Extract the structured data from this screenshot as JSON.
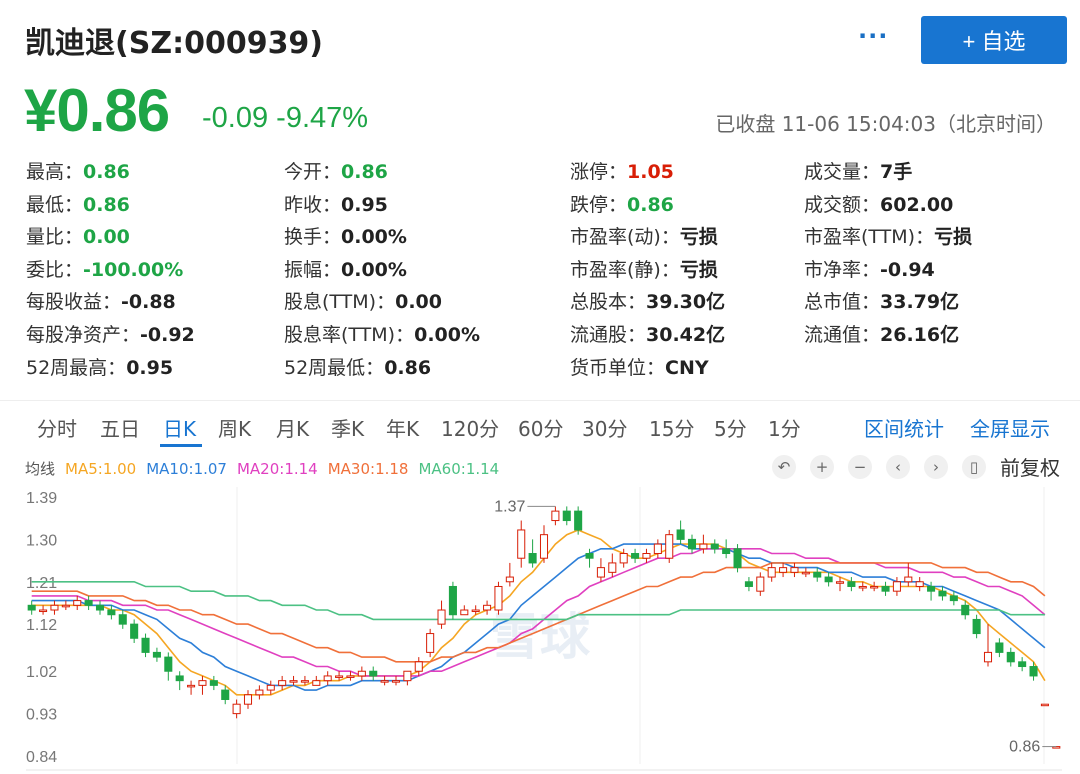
{
  "header": {
    "title": "凯迪退(SZ:000939)",
    "more_label": "···",
    "add_label": "+ 自选"
  },
  "quote": {
    "price": "¥0.86",
    "change": "-0.09 -9.47%",
    "status": "已收盘 11-06 15:04:03（北京时间）"
  },
  "stats": [
    {
      "label": "最高：",
      "value": "0.86",
      "color": "green"
    },
    {
      "label": "今开：",
      "value": "0.86",
      "color": "green"
    },
    {
      "label": "涨停：",
      "value": "1.05",
      "color": "red"
    },
    {
      "label": "成交量：",
      "value": "7手",
      "color": ""
    },
    {
      "label": "最低：",
      "value": "0.86",
      "color": "green"
    },
    {
      "label": "昨收：",
      "value": "0.95",
      "color": ""
    },
    {
      "label": "跌停：",
      "value": "0.86",
      "color": "green"
    },
    {
      "label": "成交额：",
      "value": "602.00",
      "color": ""
    },
    {
      "label": "量比：",
      "value": "0.00",
      "color": "green"
    },
    {
      "label": "换手：",
      "value": "0.00%",
      "color": ""
    },
    {
      "label": "市盈率(动)：",
      "value": "亏损",
      "color": ""
    },
    {
      "label": "市盈率(TTM)：",
      "value": "亏损",
      "color": ""
    },
    {
      "label": "委比：",
      "value": "-100.00%",
      "color": "green"
    },
    {
      "label": "振幅：",
      "value": "0.00%",
      "color": ""
    },
    {
      "label": "市盈率(静)：",
      "value": "亏损",
      "color": ""
    },
    {
      "label": "市净率：",
      "value": "-0.94",
      "color": ""
    },
    {
      "label": "每股收益：",
      "value": "-0.88",
      "color": ""
    },
    {
      "label": "股息(TTM)：",
      "value": "0.00",
      "color": ""
    },
    {
      "label": "总股本：",
      "value": "39.30亿",
      "color": ""
    },
    {
      "label": "总市值：",
      "value": "33.79亿",
      "color": ""
    },
    {
      "label": "每股净资产：",
      "value": "-0.92",
      "color": ""
    },
    {
      "label": "股息率(TTM)：",
      "value": "0.00%",
      "color": ""
    },
    {
      "label": "流通股：",
      "value": "30.42亿",
      "color": ""
    },
    {
      "label": "流通值：",
      "value": "26.16亿",
      "color": ""
    },
    {
      "label": "52周最高：",
      "value": "0.95",
      "color": ""
    },
    {
      "label": "52周最低：",
      "value": "0.86",
      "color": ""
    },
    {
      "label": "货币单位：",
      "value": "CNY",
      "color": ""
    }
  ],
  "tabs": [
    "分时",
    "五日",
    "日K",
    "周K",
    "月K",
    "季K",
    "年K",
    "120分",
    "60分",
    "30分",
    "15分",
    "5分",
    "1分"
  ],
  "active_tab": "日K",
  "tab_links": [
    "区间统计",
    "全屏显示"
  ],
  "legend": [
    {
      "text": "均线",
      "color": "#555555"
    },
    {
      "text": "MA5:1.00",
      "color": "#f5a623"
    },
    {
      "text": "MA10:1.07",
      "color": "#2d7fd8"
    },
    {
      "text": "MA20:1.14",
      "color": "#e040c0"
    },
    {
      "text": "MA30:1.18",
      "color": "#f0703a"
    },
    {
      "text": "MA60:1.14",
      "color": "#4cc184"
    }
  ],
  "tools": {
    "icons": [
      "undo-icon",
      "zoom-in-icon",
      "zoom-out-icon",
      "prev-icon",
      "next-icon",
      "candle-icon"
    ],
    "glyphs": [
      "↶",
      "+",
      "−",
      "‹",
      "›",
      "▯"
    ],
    "fq_label": "前复权"
  },
  "chart_data": {
    "type": "candlestick",
    "ylim": [
      0.84,
      1.39
    ],
    "y_ticks": [
      "1.39",
      "1.30",
      "1.21",
      "1.12",
      "1.02",
      "0.93",
      "0.84"
    ],
    "y_tick_values": [
      1.39,
      1.3,
      1.21,
      1.12,
      1.02,
      0.93,
      0.84
    ],
    "max_label": "1.37",
    "last_label": "0.86",
    "watermark": "雪球",
    "up_color": "#d81e06",
    "down_color": "#1ea546",
    "candles": [
      [
        1.16,
        1.15,
        1.17,
        1.14
      ],
      [
        1.15,
        1.15,
        1.16,
        1.14
      ],
      [
        1.15,
        1.16,
        1.17,
        1.14
      ],
      [
        1.16,
        1.16,
        1.17,
        1.15
      ],
      [
        1.16,
        1.17,
        1.18,
        1.15
      ],
      [
        1.17,
        1.16,
        1.18,
        1.15
      ],
      [
        1.16,
        1.15,
        1.17,
        1.14
      ],
      [
        1.15,
        1.14,
        1.16,
        1.13
      ],
      [
        1.14,
        1.12,
        1.15,
        1.11
      ],
      [
        1.12,
        1.09,
        1.13,
        1.08
      ],
      [
        1.09,
        1.06,
        1.1,
        1.05
      ],
      [
        1.06,
        1.05,
        1.07,
        1.04
      ],
      [
        1.05,
        1.02,
        1.06,
        1.0
      ],
      [
        1.01,
        1.0,
        1.02,
        0.98
      ],
      [
        0.99,
        0.99,
        1.0,
        0.97
      ],
      [
        0.99,
        1.0,
        1.01,
        0.97
      ],
      [
        1.0,
        0.99,
        1.01,
        0.98
      ],
      [
        0.98,
        0.96,
        0.99,
        0.95
      ],
      [
        0.93,
        0.95,
        0.96,
        0.92
      ],
      [
        0.95,
        0.97,
        0.98,
        0.94
      ],
      [
        0.97,
        0.98,
        0.99,
        0.96
      ],
      [
        0.98,
        0.99,
        1.0,
        0.97
      ],
      [
        0.99,
        1.0,
        1.01,
        0.98
      ],
      [
        1.0,
        1.0,
        1.01,
        0.99
      ],
      [
        1.0,
        1.0,
        1.01,
        0.99
      ],
      [
        0.99,
        1.0,
        1.01,
        0.99
      ],
      [
        1.0,
        1.01,
        1.02,
        0.99
      ],
      [
        1.01,
        1.01,
        1.02,
        1.0
      ],
      [
        1.01,
        1.01,
        1.02,
        1.0
      ],
      [
        1.01,
        1.02,
        1.03,
        1.0
      ],
      [
        1.02,
        1.01,
        1.03,
        1.0
      ],
      [
        1.0,
        1.0,
        1.01,
        0.99
      ],
      [
        1.0,
        1.0,
        1.01,
        0.99
      ],
      [
        1.0,
        1.02,
        1.02,
        0.99
      ],
      [
        1.02,
        1.04,
        1.05,
        1.01
      ],
      [
        1.06,
        1.1,
        1.11,
        1.05
      ],
      [
        1.12,
        1.15,
        1.17,
        1.11
      ],
      [
        1.2,
        1.14,
        1.21,
        1.13
      ],
      [
        1.14,
        1.15,
        1.16,
        1.14
      ],
      [
        1.15,
        1.15,
        1.16,
        1.14
      ],
      [
        1.15,
        1.16,
        1.17,
        1.14
      ],
      [
        1.15,
        1.2,
        1.21,
        1.14
      ],
      [
        1.21,
        1.22,
        1.25,
        1.2
      ],
      [
        1.26,
        1.32,
        1.34,
        1.24
      ],
      [
        1.27,
        1.25,
        1.3,
        1.24
      ],
      [
        1.26,
        1.31,
        1.33,
        1.25
      ],
      [
        1.34,
        1.36,
        1.37,
        1.33
      ],
      [
        1.36,
        1.34,
        1.37,
        1.33
      ],
      [
        1.36,
        1.32,
        1.37,
        1.31
      ],
      [
        1.27,
        1.26,
        1.28,
        1.24
      ],
      [
        1.22,
        1.24,
        1.26,
        1.21
      ],
      [
        1.23,
        1.25,
        1.27,
        1.22
      ],
      [
        1.25,
        1.27,
        1.28,
        1.24
      ],
      [
        1.27,
        1.26,
        1.28,
        1.25
      ],
      [
        1.26,
        1.27,
        1.28,
        1.25
      ],
      [
        1.27,
        1.29,
        1.3,
        1.26
      ],
      [
        1.26,
        1.31,
        1.32,
        1.25
      ],
      [
        1.32,
        1.3,
        1.34,
        1.29
      ],
      [
        1.3,
        1.28,
        1.31,
        1.27
      ],
      [
        1.28,
        1.29,
        1.31,
        1.27
      ],
      [
        1.29,
        1.28,
        1.3,
        1.27
      ],
      [
        1.28,
        1.27,
        1.3,
        1.26
      ],
      [
        1.28,
        1.24,
        1.29,
        1.23
      ],
      [
        1.21,
        1.2,
        1.22,
        1.19
      ],
      [
        1.19,
        1.22,
        1.23,
        1.18
      ],
      [
        1.22,
        1.24,
        1.25,
        1.21
      ],
      [
        1.23,
        1.24,
        1.25,
        1.22
      ],
      [
        1.23,
        1.24,
        1.25,
        1.22
      ],
      [
        1.23,
        1.23,
        1.24,
        1.22
      ],
      [
        1.23,
        1.22,
        1.24,
        1.21
      ],
      [
        1.22,
        1.21,
        1.23,
        1.2
      ],
      [
        1.21,
        1.21,
        1.22,
        1.19
      ],
      [
        1.21,
        1.2,
        1.22,
        1.19
      ],
      [
        1.2,
        1.2,
        1.21,
        1.19
      ],
      [
        1.2,
        1.2,
        1.21,
        1.19
      ],
      [
        1.2,
        1.19,
        1.21,
        1.18
      ],
      [
        1.19,
        1.21,
        1.22,
        1.18
      ],
      [
        1.21,
        1.22,
        1.25,
        1.2
      ],
      [
        1.2,
        1.21,
        1.22,
        1.19
      ],
      [
        1.2,
        1.19,
        1.21,
        1.17
      ],
      [
        1.19,
        1.18,
        1.2,
        1.17
      ],
      [
        1.18,
        1.17,
        1.19,
        1.16
      ],
      [
        1.16,
        1.14,
        1.17,
        1.13
      ],
      [
        1.13,
        1.1,
        1.14,
        1.09
      ],
      [
        1.04,
        1.06,
        1.12,
        1.03
      ],
      [
        1.08,
        1.06,
        1.09,
        1.05
      ],
      [
        1.06,
        1.04,
        1.07,
        1.03
      ],
      [
        1.04,
        1.03,
        1.05,
        1.02
      ],
      [
        1.03,
        1.01,
        1.04,
        1.0
      ],
      [
        0.95,
        0.95,
        0.95,
        0.95
      ],
      [
        0.86,
        0.86,
        0.86,
        0.86
      ]
    ],
    "ma": [
      {
        "name": "MA5",
        "color": "#f5a623",
        "values": [
          1.16,
          1.16,
          1.16,
          1.16,
          1.16,
          1.16,
          1.16,
          1.15,
          1.15,
          1.14,
          1.12,
          1.1,
          1.07,
          1.04,
          1.02,
          1.01,
          1.0,
          0.99,
          0.97,
          0.97,
          0.97,
          0.97,
          0.98,
          0.99,
          0.99,
          1.0,
          1.0,
          1.0,
          1.01,
          1.01,
          1.01,
          1.01,
          1.01,
          1.01,
          1.02,
          1.04,
          1.07,
          1.09,
          1.12,
          1.14,
          1.15,
          1.16,
          1.18,
          1.21,
          1.23,
          1.26,
          1.29,
          1.31,
          1.32,
          1.31,
          1.3,
          1.28,
          1.27,
          1.26,
          1.26,
          1.27,
          1.28,
          1.29,
          1.29,
          1.29,
          1.29,
          1.28,
          1.27,
          1.25,
          1.24,
          1.23,
          1.23,
          1.23,
          1.23,
          1.23,
          1.23,
          1.22,
          1.21,
          1.21,
          1.2,
          1.2,
          1.2,
          1.2,
          1.2,
          1.2,
          1.19,
          1.18,
          1.17,
          1.15,
          1.12,
          1.1,
          1.08,
          1.06,
          1.04,
          1.0
        ]
      },
      {
        "name": "MA10",
        "color": "#2d7fd8",
        "values": [
          1.17,
          1.17,
          1.17,
          1.17,
          1.17,
          1.16,
          1.16,
          1.16,
          1.15,
          1.15,
          1.14,
          1.13,
          1.11,
          1.09,
          1.08,
          1.06,
          1.05,
          1.03,
          1.02,
          1.01,
          1.0,
          0.99,
          0.99,
          0.99,
          0.98,
          0.98,
          0.99,
          0.99,
          0.99,
          1.0,
          1.0,
          1.0,
          1.0,
          1.0,
          1.01,
          1.02,
          1.03,
          1.05,
          1.06,
          1.08,
          1.1,
          1.12,
          1.13,
          1.16,
          1.18,
          1.2,
          1.22,
          1.24,
          1.26,
          1.27,
          1.28,
          1.28,
          1.29,
          1.29,
          1.29,
          1.29,
          1.29,
          1.29,
          1.28,
          1.28,
          1.28,
          1.28,
          1.27,
          1.26,
          1.26,
          1.25,
          1.25,
          1.24,
          1.24,
          1.24,
          1.23,
          1.23,
          1.23,
          1.22,
          1.22,
          1.22,
          1.21,
          1.21,
          1.21,
          1.2,
          1.2,
          1.19,
          1.18,
          1.17,
          1.16,
          1.15,
          1.13,
          1.11,
          1.09,
          1.07
        ]
      },
      {
        "name": "MA20",
        "color": "#e040c0",
        "values": [
          1.18,
          1.18,
          1.18,
          1.18,
          1.18,
          1.17,
          1.17,
          1.17,
          1.16,
          1.16,
          1.16,
          1.15,
          1.15,
          1.14,
          1.13,
          1.12,
          1.11,
          1.1,
          1.09,
          1.08,
          1.07,
          1.06,
          1.05,
          1.05,
          1.04,
          1.03,
          1.03,
          1.02,
          1.02,
          1.01,
          1.01,
          1.01,
          1.01,
          1.01,
          1.01,
          1.02,
          1.02,
          1.03,
          1.04,
          1.05,
          1.06,
          1.07,
          1.08,
          1.1,
          1.11,
          1.13,
          1.15,
          1.17,
          1.18,
          1.2,
          1.21,
          1.22,
          1.23,
          1.24,
          1.25,
          1.26,
          1.26,
          1.27,
          1.27,
          1.28,
          1.28,
          1.28,
          1.28,
          1.28,
          1.28,
          1.27,
          1.27,
          1.27,
          1.26,
          1.26,
          1.26,
          1.25,
          1.25,
          1.25,
          1.25,
          1.24,
          1.24,
          1.24,
          1.23,
          1.23,
          1.23,
          1.22,
          1.22,
          1.21,
          1.2,
          1.2,
          1.19,
          1.18,
          1.16,
          1.14
        ]
      },
      {
        "name": "MA30",
        "color": "#f0703a",
        "values": [
          1.19,
          1.19,
          1.19,
          1.19,
          1.19,
          1.18,
          1.18,
          1.18,
          1.18,
          1.17,
          1.17,
          1.16,
          1.16,
          1.15,
          1.15,
          1.14,
          1.14,
          1.13,
          1.12,
          1.12,
          1.11,
          1.1,
          1.1,
          1.09,
          1.08,
          1.07,
          1.07,
          1.06,
          1.06,
          1.05,
          1.05,
          1.05,
          1.04,
          1.04,
          1.04,
          1.04,
          1.05,
          1.05,
          1.06,
          1.06,
          1.07,
          1.07,
          1.08,
          1.09,
          1.1,
          1.11,
          1.12,
          1.13,
          1.14,
          1.15,
          1.16,
          1.17,
          1.18,
          1.19,
          1.2,
          1.2,
          1.21,
          1.22,
          1.22,
          1.23,
          1.23,
          1.24,
          1.24,
          1.24,
          1.24,
          1.25,
          1.25,
          1.25,
          1.25,
          1.25,
          1.25,
          1.25,
          1.25,
          1.25,
          1.25,
          1.25,
          1.25,
          1.25,
          1.25,
          1.25,
          1.24,
          1.24,
          1.24,
          1.23,
          1.23,
          1.22,
          1.21,
          1.21,
          1.2,
          1.18
        ]
      },
      {
        "name": "MA60",
        "color": "#4cc184",
        "values": [
          1.21,
          1.21,
          1.21,
          1.21,
          1.21,
          1.21,
          1.21,
          1.21,
          1.21,
          1.21,
          1.2,
          1.2,
          1.2,
          1.2,
          1.19,
          1.19,
          1.19,
          1.18,
          1.18,
          1.18,
          1.17,
          1.17,
          1.16,
          1.16,
          1.16,
          1.15,
          1.15,
          1.14,
          1.14,
          1.14,
          1.13,
          1.13,
          1.13,
          1.13,
          1.13,
          1.13,
          1.13,
          1.13,
          1.13,
          1.13,
          1.13,
          1.13,
          1.13,
          1.13,
          1.13,
          1.13,
          1.13,
          1.13,
          1.14,
          1.14,
          1.14,
          1.14,
          1.14,
          1.14,
          1.14,
          1.14,
          1.14,
          1.15,
          1.15,
          1.15,
          1.15,
          1.15,
          1.15,
          1.15,
          1.15,
          1.15,
          1.15,
          1.15,
          1.15,
          1.15,
          1.15,
          1.15,
          1.15,
          1.15,
          1.15,
          1.15,
          1.15,
          1.15,
          1.15,
          1.15,
          1.15,
          1.15,
          1.15,
          1.15,
          1.15,
          1.15,
          1.14,
          1.14,
          1.14,
          1.14
        ]
      }
    ]
  }
}
